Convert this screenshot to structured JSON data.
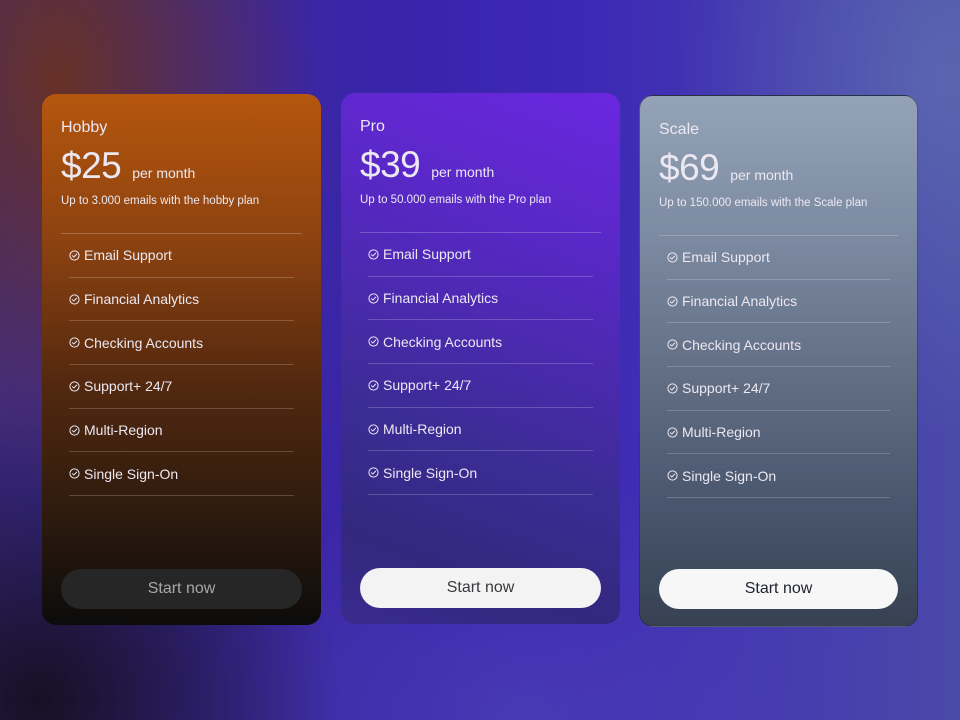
{
  "plans": [
    {
      "name": "Hobby",
      "price": "$25",
      "period": "per month",
      "description": "Up to 3.000 emails with the hobby plan",
      "features": [
        "Email Support",
        "Financial Analytics",
        "Checking Accounts",
        "Support+ 24/7",
        "Multi-Region",
        "Single Sign-On"
      ],
      "cta_label": "Start now",
      "feature_icon": "check-circle-icon"
    },
    {
      "name": "Pro",
      "price": "$39",
      "period": "per month",
      "description": "Up to 50.000 emails with the Pro plan",
      "features": [
        "Email Support",
        "Financial Analytics",
        "Checking Accounts",
        "Support+ 24/7",
        "Multi-Region",
        "Single Sign-On"
      ],
      "cta_label": "Start now",
      "feature_icon": "check-circle-icon"
    },
    {
      "name": "Scale",
      "price": "$69",
      "period": "per month",
      "description": "Up to 150.000 emails with the Scale plan",
      "features": [
        "Email Support",
        "Financial Analytics",
        "Checking Accounts",
        "Support+ 24/7",
        "Multi-Region",
        "Single Sign-On"
      ],
      "cta_label": "Start now",
      "feature_icon": "check-circle-icon"
    }
  ],
  "colors": {
    "hobby_accent": "#b5560d",
    "pro_accent": "#6b27e0",
    "scale_accent": "#95a3b8",
    "background": "#3a24ae"
  }
}
